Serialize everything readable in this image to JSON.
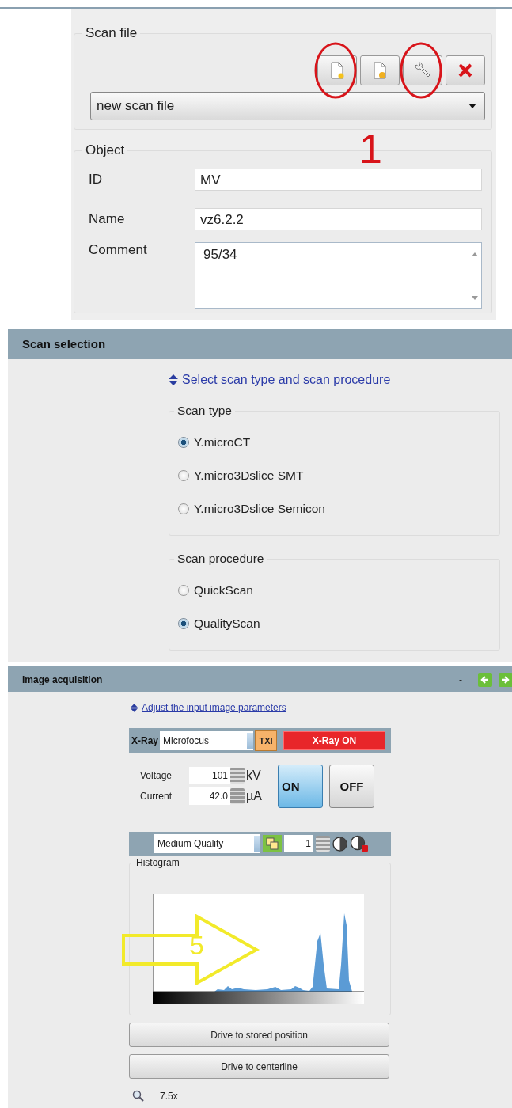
{
  "scan_file": {
    "title": "Scan file",
    "buttons": [
      {
        "kind": "new",
        "circled": true
      },
      {
        "kind": "load",
        "circled": false
      },
      {
        "kind": "settings",
        "circled": true
      },
      {
        "kind": "delete",
        "circled": false
      }
    ],
    "annotation_label": "1",
    "file_select": {
      "value": "new scan file"
    }
  },
  "object": {
    "title": "Object",
    "fields": [
      {
        "kind": "line",
        "label": "ID",
        "value": "MV"
      },
      {
        "kind": "line",
        "label": "Name",
        "value": "vz6.2.2"
      },
      {
        "kind": "area",
        "label": "Comment",
        "value": "95/34"
      }
    ]
  },
  "scan_selection": {
    "title": "Scan selection",
    "link": "Select scan type and scan procedure",
    "groups": [
      {
        "title": "Scan type",
        "options": [
          {
            "label": "Y.microCT",
            "selected": true
          },
          {
            "label": "Y.micro3Dslice SMT",
            "selected": false
          },
          {
            "label": "Y.micro3Dslice Semicon",
            "selected": false
          }
        ]
      },
      {
        "title": "Scan procedure",
        "options": [
          {
            "label": "QuickScan",
            "selected": false
          },
          {
            "label": "QualityScan",
            "selected": true
          }
        ]
      }
    ]
  },
  "image_acquisition": {
    "title": "Image acquisition",
    "header_mark": "-",
    "link": "Adjust the input image parameters",
    "xray": {
      "label": "X-Ray",
      "source": "Microfocus",
      "txi": "TXI",
      "status": "X-Ray ON",
      "on": true
    },
    "parameters": [
      {
        "label": "Voltage",
        "value": "101",
        "unit": "kV"
      },
      {
        "label": "Current",
        "value": "42.0",
        "unit": "µA"
      }
    ],
    "power_buttons": [
      {
        "label": "ON",
        "selected": true
      },
      {
        "label": "OFF",
        "selected": false
      }
    ],
    "quality": {
      "value": "Medium Quality",
      "count": "1"
    },
    "histogram": {
      "title": "Histogram",
      "arrow_label": "5"
    },
    "actions": [
      "Drive to stored position",
      "Drive to centerline"
    ],
    "zoom": "7.5x"
  }
}
